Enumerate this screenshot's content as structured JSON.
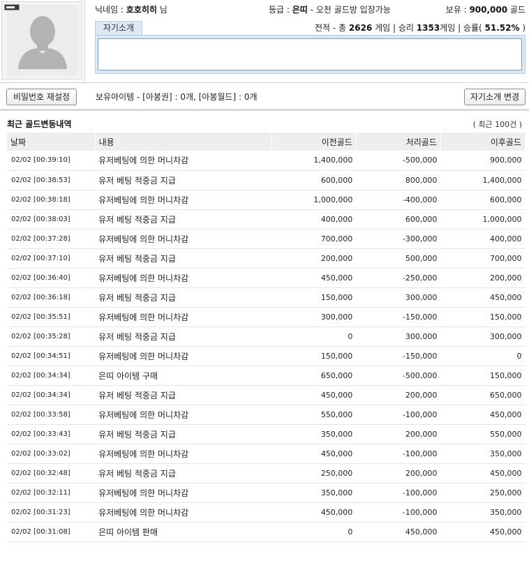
{
  "profile": {
    "nickname_label": "닉네임 : ",
    "nickname": "호호히히",
    "nickname_suffix": " 님",
    "grade_label": "등급 : ",
    "grade": "은띠",
    "grade_desc": " - 오천 골드방 입장가능",
    "gold_label": "보유 : ",
    "gold": "900,000",
    "gold_unit": " 골드",
    "intro_tab": "자기소개",
    "intro_text": "",
    "record": {
      "prefix": "전적 - 총 ",
      "total": "2626",
      "total_unit": " 게임 | 승리 ",
      "wins": "1353",
      "wins_unit": "게임 | 승률( ",
      "rate": "51.52%",
      "suffix": " )"
    }
  },
  "actions": {
    "password_reset": "비밀번호 재설정",
    "items": "보유아이템 - [아봉권] : 0개, [아봉월드] : 0개",
    "intro_change": "자기소개 변경"
  },
  "history": {
    "title": "최근 골드변동내역",
    "count": "( 최근 100건 )",
    "columns": [
      "날짜",
      "내용",
      "이전골드",
      "처리골드",
      "이후골드"
    ],
    "rows": [
      [
        "02/02 [00:39:10]",
        "유저베팅에 의한 머니차감",
        "1,400,000",
        "-500,000",
        "900,000"
      ],
      [
        "02/02 [00:38:53]",
        "유저 베팅 적중금 지급",
        "600,000",
        "800,000",
        "1,400,000"
      ],
      [
        "02/02 [00:38:18]",
        "유저베팅에 의한 머니차감",
        "1,000,000",
        "-400,000",
        "600,000"
      ],
      [
        "02/02 [00:38:03]",
        "유저 베팅 적중금 지급",
        "400,000",
        "600,000",
        "1,000,000"
      ],
      [
        "02/02 [00:37:28]",
        "유저베팅에 의한 머니차감",
        "700,000",
        "-300,000",
        "400,000"
      ],
      [
        "02/02 [00:37:10]",
        "유저 베팅 적중금 지급",
        "200,000",
        "500,000",
        "700,000"
      ],
      [
        "02/02 [00:36:40]",
        "유저베팅에 의한 머니차감",
        "450,000",
        "-250,000",
        "200,000"
      ],
      [
        "02/02 [00:36:18]",
        "유저 베팅 적중금 지급",
        "150,000",
        "300,000",
        "450,000"
      ],
      [
        "02/02 [00:35:51]",
        "유저베팅에 의한 머니차감",
        "300,000",
        "-150,000",
        "150,000"
      ],
      [
        "02/02 [00:35:28]",
        "유저 베팅 적중금 지급",
        "0",
        "300,000",
        "300,000"
      ],
      [
        "02/02 [00:34:51]",
        "유저베팅에 의한 머니차감",
        "150,000",
        "-150,000",
        "0"
      ],
      [
        "02/02 [00:34:34]",
        "은띠 아이템 구매",
        "650,000",
        "-500,000",
        "150,000"
      ],
      [
        "02/02 [00:34:34]",
        "유저 베팅 적중금 지급",
        "450,000",
        "200,000",
        "650,000"
      ],
      [
        "02/02 [00:33:58]",
        "유저베팅에 의한 머니차감",
        "550,000",
        "-100,000",
        "450,000"
      ],
      [
        "02/02 [00:33:43]",
        "유저 베팅 적중금 지급",
        "350,000",
        "200,000",
        "550,000"
      ],
      [
        "02/02 [00:33:02]",
        "유저베팅에 의한 머니차감",
        "450,000",
        "-100,000",
        "350,000"
      ],
      [
        "02/02 [00:32:48]",
        "유저 베팅 적중금 지급",
        "250,000",
        "200,000",
        "450,000"
      ],
      [
        "02/02 [00:32:11]",
        "유저베팅에 의한 머니차감",
        "350,000",
        "-100,000",
        "250,000"
      ],
      [
        "02/02 [00:31:23]",
        "유저베팅에 의한 머니차감",
        "450,000",
        "-100,000",
        "350,000"
      ],
      [
        "02/02 [00:31:08]",
        "은띠 아이템 판매",
        "0",
        "450,000",
        "450,000"
      ]
    ]
  }
}
